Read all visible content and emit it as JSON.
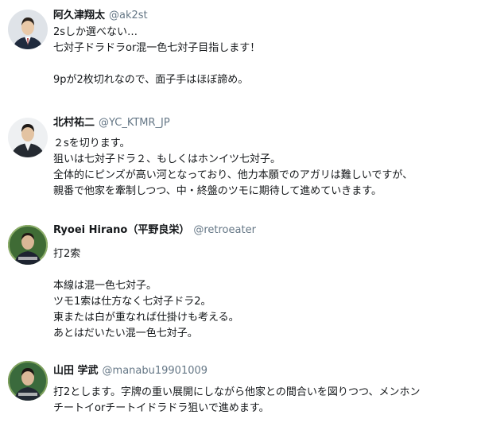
{
  "tweets": [
    {
      "name": "阿久津翔太",
      "handle": "@ak2st",
      "lines": [
        "2sしか選べない…",
        "七対子ドラドラor混一色七対子目指します！",
        "",
        "9pが2枚切れなので、面子手はほぼ諦め。"
      ]
    },
    {
      "name": "北村祐二",
      "handle": "@YC_KTMR_JP",
      "lines": [
        "２sを切ります。",
        "狙いは七対子ドラ２、もしくはホンイツ七対子。",
        "全体的にピンズが高い河となっており、他力本願でのアガリは難しいですが、",
        "親番で他家を牽制しつつ、中・終盤のツモに期待して進めていきます。"
      ]
    },
    {
      "name": "Ryoei Hirano（平野良栄）",
      "handle": "@retroeater",
      "lines": [
        "打2索",
        "",
        "本線は混一色七対子。",
        "ツモ1索は仕方なく七対子ドラ2。",
        "東または白が重なれば仕掛けも考える。",
        "あとはだいたい混一色七対子。"
      ]
    },
    {
      "name": "山田 学武",
      "handle": "@manabu19901009",
      "lines": [
        "打2とします。字牌の重い展開にしながら他家との間合いを図りつつ、メンホン",
        "チートイorチートイドラドラ狙いで進めます。"
      ]
    }
  ]
}
